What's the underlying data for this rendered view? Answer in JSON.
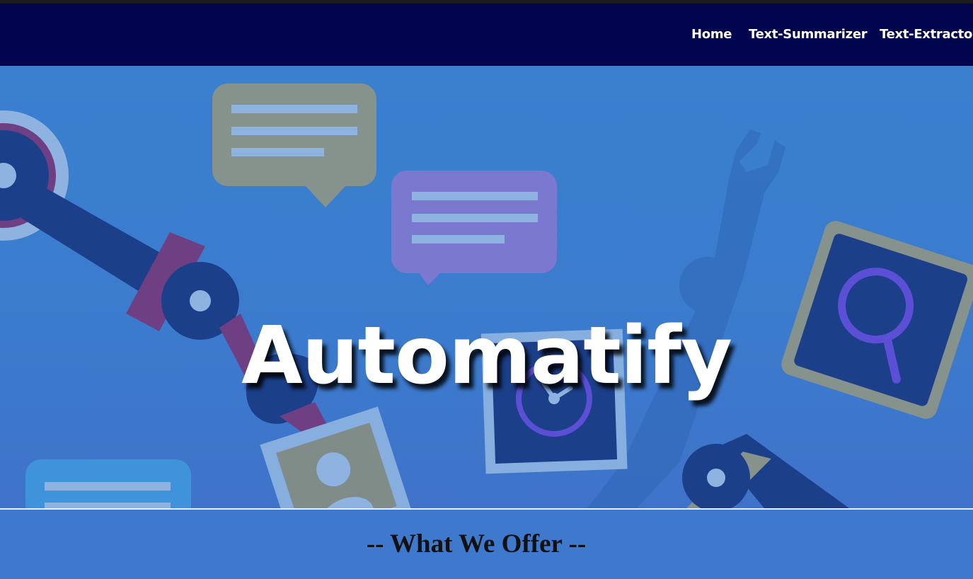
{
  "navbar": {
    "links": [
      {
        "label": "Home"
      },
      {
        "label": "Text-Summarizer"
      },
      {
        "label": "Text-Extractor"
      }
    ]
  },
  "hero": {
    "title": "Automatify"
  },
  "offer": {
    "heading": "-- What We Offer --"
  },
  "colors": {
    "navbar": "#00054e",
    "hero": "#3b7bcd",
    "robot_arm": "#1c3f8a",
    "accent_purple": "#6f3f84",
    "bubble_purple": "#7b78d0",
    "bubble_gray": "#86928c",
    "icon_violet": "#5b4fd6"
  },
  "icons": [
    "robot-arm-icon",
    "chat-bubble-icon",
    "clock-icon",
    "search-icon",
    "wrench-icon",
    "profile-photo-icon"
  ]
}
